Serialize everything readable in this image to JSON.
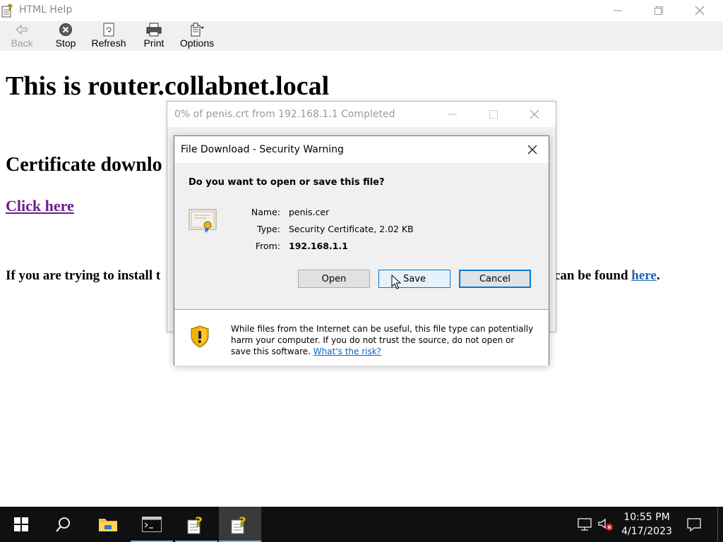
{
  "window": {
    "title": "HTML Help",
    "toolbar": [
      {
        "label": "Back",
        "icon": "back-arrow-icon",
        "disabled": true
      },
      {
        "label": "Stop",
        "icon": "stop-icon"
      },
      {
        "label": "Refresh",
        "icon": "refresh-icon"
      },
      {
        "label": "Print",
        "icon": "print-icon"
      },
      {
        "label": "Options",
        "icon": "options-icon"
      }
    ]
  },
  "page": {
    "heading": "This is router.collabnet.local",
    "subheading": "Certificate downlo",
    "link": "Click here",
    "paragraph_left": "If you are trying to install t",
    "paragraph_right": "can be found",
    "paragraph_link": "here",
    "paragraph_end": "."
  },
  "progress_window": {
    "title": "0% of penis.crt from 192.168.1.1 Completed"
  },
  "dialog": {
    "title": "File Download - Security Warning",
    "question": "Do you want to open or save this file?",
    "fields": {
      "name_label": "Name:",
      "name_value": "penis.cer",
      "type_label": "Type:",
      "type_value": "Security Certificate, 2.02 KB",
      "from_label": "From:",
      "from_value": "192.168.1.1"
    },
    "buttons": {
      "open": "Open",
      "save": "Save",
      "cancel": "Cancel"
    },
    "warning": "While files from the Internet can be useful, this file type can potentially harm your computer. If you do not trust the source, do not open or save this software.",
    "risk_link": "What's the risk?"
  },
  "taskbar": {
    "time": "10:55 PM",
    "date": "4/17/2023",
    "accent": "#76b9ed"
  }
}
